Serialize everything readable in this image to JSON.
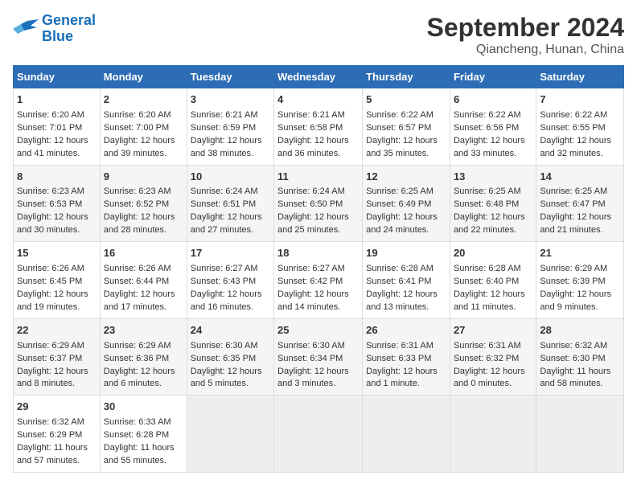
{
  "header": {
    "logo_line1": "General",
    "logo_line2": "Blue",
    "month": "September 2024",
    "location": "Qiancheng, Hunan, China"
  },
  "weekdays": [
    "Sunday",
    "Monday",
    "Tuesday",
    "Wednesday",
    "Thursday",
    "Friday",
    "Saturday"
  ],
  "weeks": [
    [
      {
        "day": "1",
        "sunrise": "6:20 AM",
        "sunset": "7:01 PM",
        "daylight": "12 hours and 41 minutes."
      },
      {
        "day": "2",
        "sunrise": "6:20 AM",
        "sunset": "7:00 PM",
        "daylight": "12 hours and 39 minutes."
      },
      {
        "day": "3",
        "sunrise": "6:21 AM",
        "sunset": "6:59 PM",
        "daylight": "12 hours and 38 minutes."
      },
      {
        "day": "4",
        "sunrise": "6:21 AM",
        "sunset": "6:58 PM",
        "daylight": "12 hours and 36 minutes."
      },
      {
        "day": "5",
        "sunrise": "6:22 AM",
        "sunset": "6:57 PM",
        "daylight": "12 hours and 35 minutes."
      },
      {
        "day": "6",
        "sunrise": "6:22 AM",
        "sunset": "6:56 PM",
        "daylight": "12 hours and 33 minutes."
      },
      {
        "day": "7",
        "sunrise": "6:22 AM",
        "sunset": "6:55 PM",
        "daylight": "12 hours and 32 minutes."
      }
    ],
    [
      {
        "day": "8",
        "sunrise": "6:23 AM",
        "sunset": "6:53 PM",
        "daylight": "12 hours and 30 minutes."
      },
      {
        "day": "9",
        "sunrise": "6:23 AM",
        "sunset": "6:52 PM",
        "daylight": "12 hours and 28 minutes."
      },
      {
        "day": "10",
        "sunrise": "6:24 AM",
        "sunset": "6:51 PM",
        "daylight": "12 hours and 27 minutes."
      },
      {
        "day": "11",
        "sunrise": "6:24 AM",
        "sunset": "6:50 PM",
        "daylight": "12 hours and 25 minutes."
      },
      {
        "day": "12",
        "sunrise": "6:25 AM",
        "sunset": "6:49 PM",
        "daylight": "12 hours and 24 minutes."
      },
      {
        "day": "13",
        "sunrise": "6:25 AM",
        "sunset": "6:48 PM",
        "daylight": "12 hours and 22 minutes."
      },
      {
        "day": "14",
        "sunrise": "6:25 AM",
        "sunset": "6:47 PM",
        "daylight": "12 hours and 21 minutes."
      }
    ],
    [
      {
        "day": "15",
        "sunrise": "6:26 AM",
        "sunset": "6:45 PM",
        "daylight": "12 hours and 19 minutes."
      },
      {
        "day": "16",
        "sunrise": "6:26 AM",
        "sunset": "6:44 PM",
        "daylight": "12 hours and 17 minutes."
      },
      {
        "day": "17",
        "sunrise": "6:27 AM",
        "sunset": "6:43 PM",
        "daylight": "12 hours and 16 minutes."
      },
      {
        "day": "18",
        "sunrise": "6:27 AM",
        "sunset": "6:42 PM",
        "daylight": "12 hours and 14 minutes."
      },
      {
        "day": "19",
        "sunrise": "6:28 AM",
        "sunset": "6:41 PM",
        "daylight": "12 hours and 13 minutes."
      },
      {
        "day": "20",
        "sunrise": "6:28 AM",
        "sunset": "6:40 PM",
        "daylight": "12 hours and 11 minutes."
      },
      {
        "day": "21",
        "sunrise": "6:29 AM",
        "sunset": "6:39 PM",
        "daylight": "12 hours and 9 minutes."
      }
    ],
    [
      {
        "day": "22",
        "sunrise": "6:29 AM",
        "sunset": "6:37 PM",
        "daylight": "12 hours and 8 minutes."
      },
      {
        "day": "23",
        "sunrise": "6:29 AM",
        "sunset": "6:36 PM",
        "daylight": "12 hours and 6 minutes."
      },
      {
        "day": "24",
        "sunrise": "6:30 AM",
        "sunset": "6:35 PM",
        "daylight": "12 hours and 5 minutes."
      },
      {
        "day": "25",
        "sunrise": "6:30 AM",
        "sunset": "6:34 PM",
        "daylight": "12 hours and 3 minutes."
      },
      {
        "day": "26",
        "sunrise": "6:31 AM",
        "sunset": "6:33 PM",
        "daylight": "12 hours and 1 minute."
      },
      {
        "day": "27",
        "sunrise": "6:31 AM",
        "sunset": "6:32 PM",
        "daylight": "12 hours and 0 minutes."
      },
      {
        "day": "28",
        "sunrise": "6:32 AM",
        "sunset": "6:30 PM",
        "daylight": "11 hours and 58 minutes."
      }
    ],
    [
      {
        "day": "29",
        "sunrise": "6:32 AM",
        "sunset": "6:29 PM",
        "daylight": "11 hours and 57 minutes."
      },
      {
        "day": "30",
        "sunrise": "6:33 AM",
        "sunset": "6:28 PM",
        "daylight": "11 hours and 55 minutes."
      },
      {
        "day": "",
        "sunrise": "",
        "sunset": "",
        "daylight": ""
      },
      {
        "day": "",
        "sunrise": "",
        "sunset": "",
        "daylight": ""
      },
      {
        "day": "",
        "sunrise": "",
        "sunset": "",
        "daylight": ""
      },
      {
        "day": "",
        "sunrise": "",
        "sunset": "",
        "daylight": ""
      },
      {
        "day": "",
        "sunrise": "",
        "sunset": "",
        "daylight": ""
      }
    ]
  ]
}
